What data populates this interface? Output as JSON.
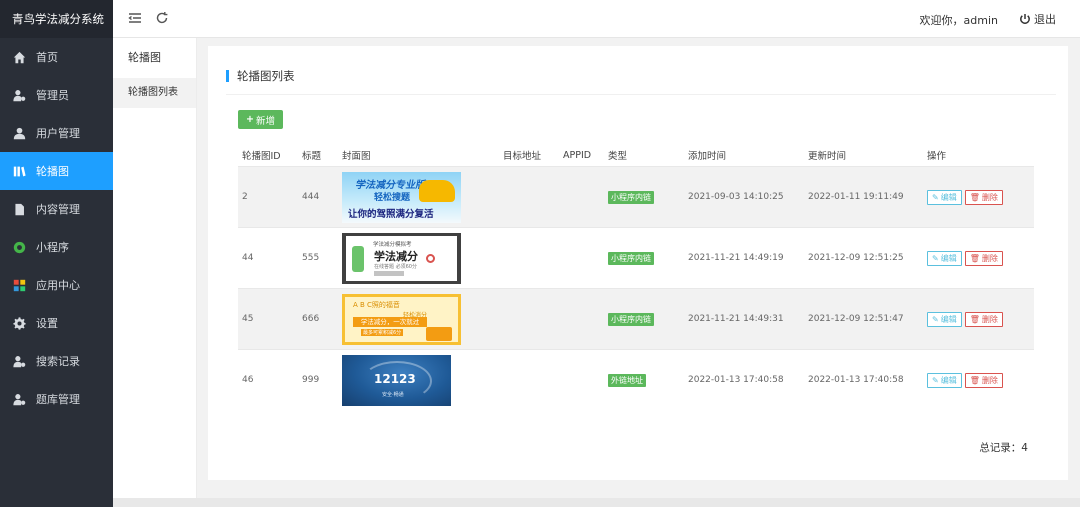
{
  "app": {
    "title": "青鸟学法减分系统"
  },
  "sidebar": {
    "items": [
      {
        "label": "首页",
        "icon": "home-icon"
      },
      {
        "label": "管理员",
        "icon": "admin-icon"
      },
      {
        "label": "用户管理",
        "icon": "user-icon"
      },
      {
        "label": "轮播图",
        "icon": "carousel-icon",
        "active": true
      },
      {
        "label": "内容管理",
        "icon": "document-icon"
      },
      {
        "label": "小程序",
        "icon": "miniprogram-icon"
      },
      {
        "label": "应用中心",
        "icon": "apps-icon"
      },
      {
        "label": "设置",
        "icon": "gear-icon"
      },
      {
        "label": "搜索记录",
        "icon": "search-record-icon"
      },
      {
        "label": "题库管理",
        "icon": "question-bank-icon"
      }
    ]
  },
  "header": {
    "welcome": "欢迎你，admin",
    "logout": "退出"
  },
  "submenu": {
    "title": "轮播图",
    "items": [
      {
        "label": "轮播图列表"
      }
    ]
  },
  "main": {
    "title": "轮播图列表",
    "add_button": "新增",
    "total": "总记录：4",
    "columns": [
      "轮播图ID",
      "标题",
      "封面图",
      "目标地址",
      "APPID",
      "类型",
      "添加时间",
      "更新时间",
      "操作"
    ],
    "edit_label": "编辑",
    "delete_label": "删除",
    "rows": [
      {
        "id": "2",
        "title": "444",
        "target": "",
        "appid": "",
        "type": "小程序内链",
        "added": "2021-09-03 14:10:25",
        "updated": "2022-01-11 19:11:49",
        "cover": {
          "line1": "学法减分专业版",
          "line2": "轻松搜题",
          "line3": "让你的驾照满分复活"
        }
      },
      {
        "id": "44",
        "title": "555",
        "target": "",
        "appid": "",
        "type": "小程序内链",
        "added": "2021-11-21 14:49:19",
        "updated": "2021-12-09 12:51:25",
        "cover": {
          "line1": "学法减分模拟考",
          "line2": "学法减分",
          "line3": "在线答题 必须60分"
        }
      },
      {
        "id": "45",
        "title": "666",
        "target": "",
        "appid": "",
        "type": "小程序内链",
        "added": "2021-11-21 14:49:31",
        "updated": "2021-12-09 12:51:47",
        "cover": {
          "line1": "A B C照的福音",
          "line2": "轻松消分",
          "line3": "学法减分，一次就过",
          "line4": "最多可累积减6分"
        }
      },
      {
        "id": "46",
        "title": "999",
        "target": "",
        "appid": "",
        "type": "外链地址",
        "added": "2022-01-13 17:40:58",
        "updated": "2022-01-13 17:40:58",
        "cover": {
          "line1": "12123",
          "line2": "安全·畅通"
        }
      }
    ]
  },
  "colors": {
    "accent": "#1e9fff",
    "sidebar_bg": "#2a2f38",
    "success": "#5cb85c",
    "info": "#5bc0de",
    "danger": "#d9534f"
  }
}
